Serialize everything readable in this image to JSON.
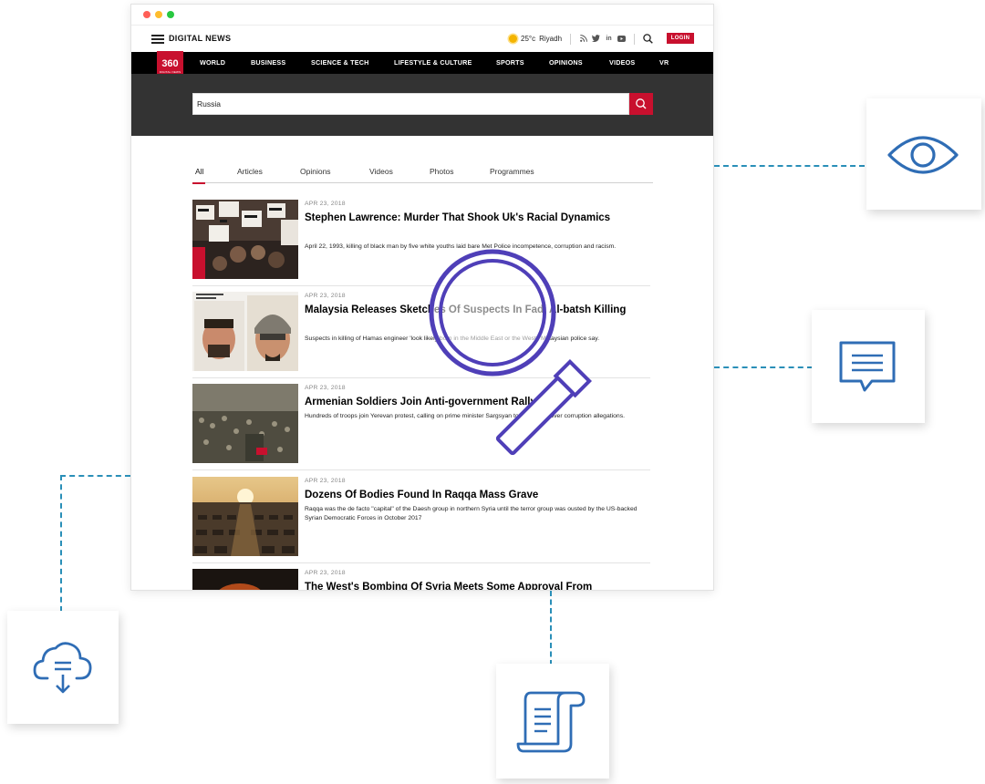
{
  "colors": {
    "accent": "#c8102e",
    "nav_bg": "#000000",
    "search_band_bg": "#333333",
    "icon_blue": "#2f6db5",
    "magnifier": "#4f3fb8",
    "connector": "#2a8fb8"
  },
  "header": {
    "brand": "DIGITAL NEWS",
    "weather": {
      "temp": "25°c",
      "city": "Riyadh"
    },
    "login_label": "LOGIN"
  },
  "nav": {
    "logo": {
      "number": "360",
      "caption": "DIGITAL NEWS"
    },
    "items": [
      "WORLD",
      "BUSINESS",
      "SCIENCE & TECH",
      "LIFESTYLE & CULTURE",
      "SPORTS",
      "OPINIONS",
      "VIDEOS",
      "VR"
    ]
  },
  "search": {
    "value": "Russia"
  },
  "tabs": [
    {
      "label": "All",
      "active": true
    },
    {
      "label": "Articles"
    },
    {
      "label": "Opinions"
    },
    {
      "label": "Videos"
    },
    {
      "label": "Photos"
    },
    {
      "label": "Programmes"
    }
  ],
  "results": [
    {
      "date": "APR 23, 2018",
      "title": "Stephen Lawrence: Murder That Shook Uk's Racial Dynamics",
      "desc": "April 22, 1993, killing of black man by five white youths laid bare Met Police incompetence, corruption and racism.",
      "image": "protest-signs"
    },
    {
      "date": "APR 23, 2018",
      "title": "Malaysia Releases Sketches Of Suspects In Fadi Al-batsh Killing",
      "desc": "Suspects in killing of Hamas engineer 'look likely born in the Middle East or the West', Malaysian police say.",
      "image": "suspect-sketches"
    },
    {
      "date": "APR 23, 2018",
      "title": "Armenian Soldiers Join Anti-government Rally",
      "desc": "Hundreds of troops join Yerevan protest, calling on prime minister Sargsyan to step down over corruption allegations.",
      "image": "crowd"
    },
    {
      "date": "APR 23, 2018",
      "title": "Dozens Of Bodies Found In Raqqa Mass Grave",
      "desc": "Raqqa was the de facto \"capital\" of the Daesh group in northern Syria until the terror group was ousted by the US-backed Syrian Democratic Forces in October 2017",
      "image": "mass-grave"
    },
    {
      "date": "APR 23, 2018",
      "title": "The West's Bombing Of Syria Meets Some Approval From",
      "desc": "",
      "image": "bombing"
    }
  ],
  "feature_icons": [
    "eye-icon",
    "chat-message-icon",
    "cloud-download-icon",
    "document-scroll-icon"
  ]
}
